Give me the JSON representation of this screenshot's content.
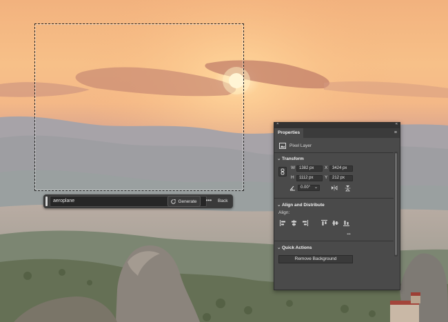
{
  "taskbar": {
    "prompt_value": "aeroplane",
    "generate_label": "Generate",
    "more_label": "•••",
    "back_label": "Back"
  },
  "panel": {
    "close_glyph": "×",
    "collapse_glyph": "«",
    "tab_label": "Properties",
    "menu_glyph": "≡",
    "layer_type": "Pixel Layer",
    "transform": {
      "title": "Transform",
      "w_label": "W",
      "w_value": "1382 px",
      "h_label": "H",
      "h_value": "1112 px",
      "x_label": "X",
      "x_value": "3424 px",
      "y_label": "Y",
      "y_value": "212 px",
      "angle_value": "0.00°"
    },
    "align": {
      "title": "Align and Distribute",
      "align_label": "Align:",
      "more_label": "•••"
    },
    "quick_actions": {
      "title": "Quick Actions",
      "remove_bg_label": "Remove Background"
    }
  },
  "colors": {
    "sky_top": "#f3b684",
    "sun": "#fff6d8",
    "panel_bg": "#4a4a4a",
    "taskbar_bg": "#3a3a3a"
  }
}
